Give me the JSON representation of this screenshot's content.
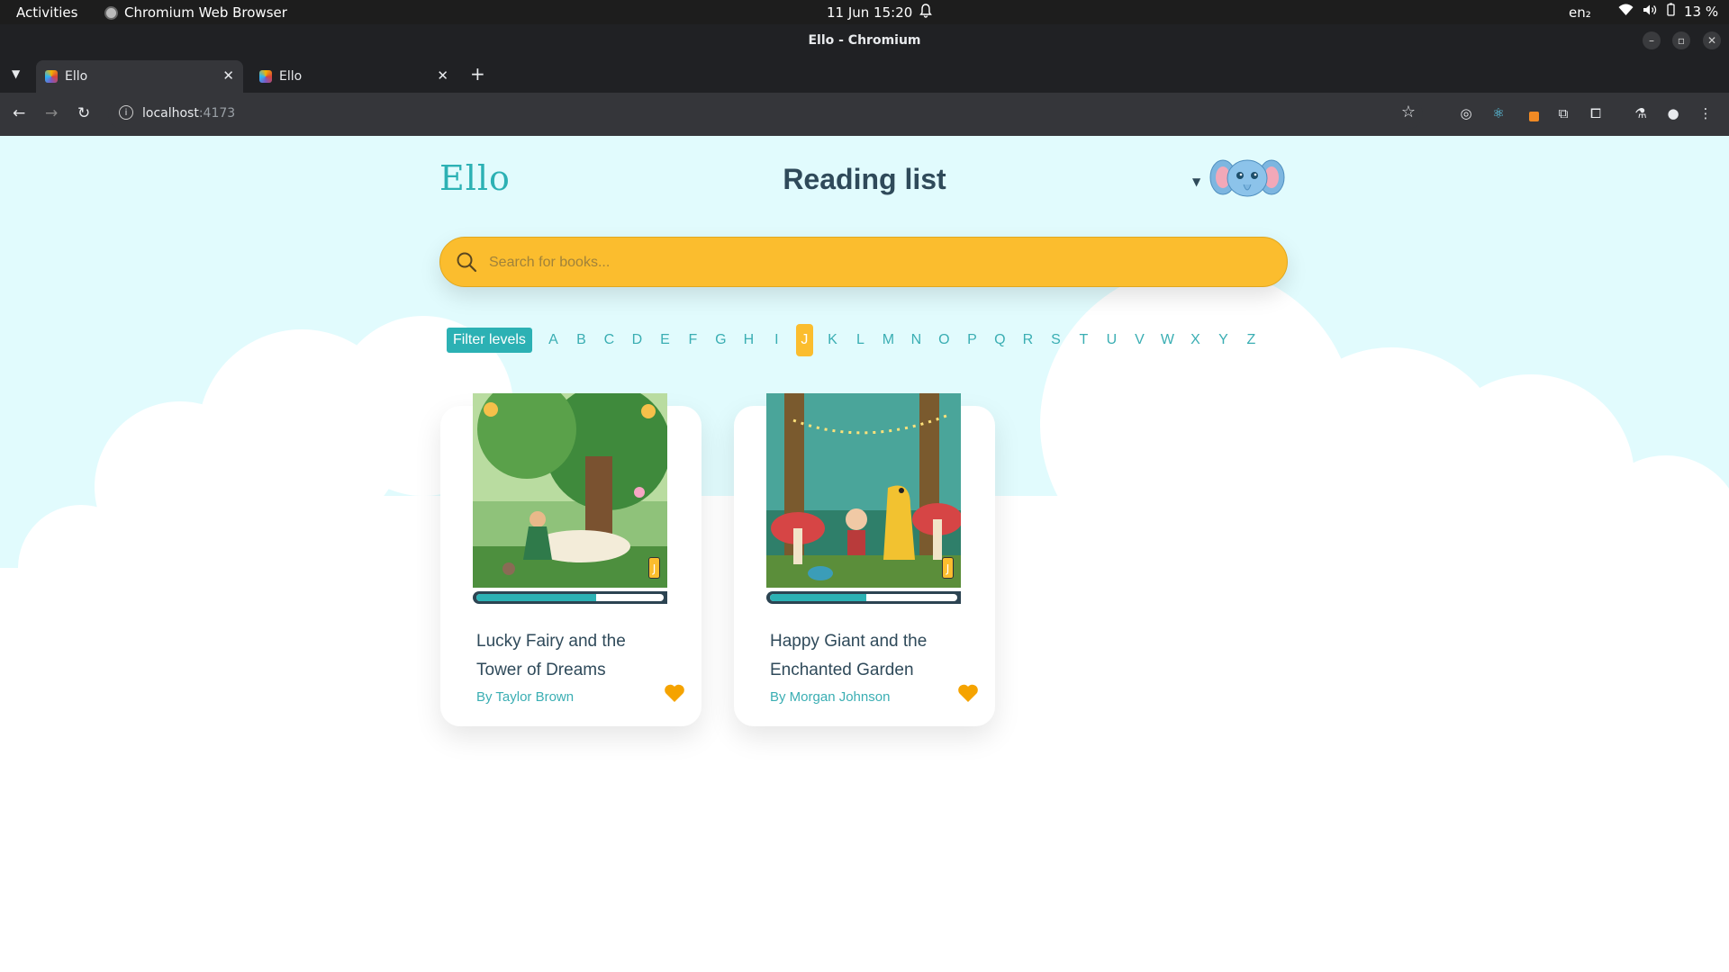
{
  "os": {
    "activities": "Activities",
    "app_name": "Chromium Web Browser",
    "clock": "11 Jun  15:20",
    "lang": "en₂",
    "battery": "13 %"
  },
  "browser": {
    "window_title": "Ello - Chromium",
    "tabs": [
      {
        "label": "Ello"
      },
      {
        "label": "Ello"
      }
    ],
    "url_host": "localhost",
    "url_port": ":4173"
  },
  "page": {
    "logo": "Ello",
    "title": "Reading list",
    "search": {
      "placeholder": "Search for books..."
    },
    "filter_label": "Filter levels",
    "levels": [
      "A",
      "B",
      "C",
      "D",
      "E",
      "F",
      "G",
      "H",
      "I",
      "J",
      "K",
      "L",
      "M",
      "N",
      "O",
      "P",
      "Q",
      "R",
      "S",
      "T",
      "U",
      "V",
      "W",
      "X",
      "Y",
      "Z"
    ],
    "selected_level": "J",
    "books": [
      {
        "title": "Lucky Fairy and the Tower of Dreams",
        "author": "By Taylor Brown",
        "level": "J",
        "progress": 0.6,
        "favorite": true
      },
      {
        "title": "Happy Giant and the Enchanted Garden",
        "author": "By Morgan Johnson",
        "level": "J",
        "progress": 0.47,
        "favorite": true
      }
    ]
  },
  "colors": {
    "brand_teal": "#2cb1b4",
    "accent_yellow": "#fbbd2e",
    "heart": "#f5a300",
    "page_bg": "#e1fbfd"
  }
}
